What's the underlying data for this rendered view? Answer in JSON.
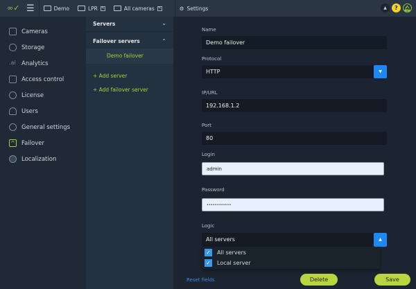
{
  "topbar": {
    "tabs": [
      {
        "label": "Demo",
        "editable": false
      },
      {
        "label": "LPR",
        "editable": true
      },
      {
        "label": "All cameras",
        "editable": true
      }
    ],
    "settings": "Settings",
    "help": "?"
  },
  "sidebar": {
    "items": [
      {
        "label": "Cameras",
        "icon": "camera-chip-icon"
      },
      {
        "label": "Storage",
        "icon": "database-icon"
      },
      {
        "label": "Analytics",
        "icon": "analytics-icon"
      },
      {
        "label": "Access control",
        "icon": "door-icon"
      },
      {
        "label": "License",
        "icon": "cloud-icon"
      },
      {
        "label": "Users",
        "icon": "user-icon"
      },
      {
        "label": "General settings",
        "icon": "gear-icon"
      },
      {
        "label": "Failover",
        "icon": "failover-icon",
        "active": true
      },
      {
        "label": "Localization",
        "icon": "globe-icon"
      }
    ]
  },
  "servers": {
    "servers_header": "Servers",
    "failover_header": "Failover servers",
    "selected": "Demo failover",
    "add_server": "+ Add server",
    "add_failover": "+ Add failover server"
  },
  "form": {
    "name_label": "Name",
    "name": "Demo failover",
    "protocol_label": "Protocol",
    "protocol": "HTTP",
    "ip_label": "IP/URL",
    "ip": "192.168.1.2",
    "port_label": "Port",
    "port": "80",
    "login_label": "Login",
    "login": "admin",
    "password_label": "Password",
    "password": "••••••••••••",
    "logic_label": "Logic",
    "logic": "All servers",
    "logic_options": [
      {
        "label": "All servers",
        "checked": true
      },
      {
        "label": "Local server",
        "checked": true
      }
    ],
    "reset": "Reset fields",
    "delete": "Delete",
    "save": "Save"
  },
  "colors": {
    "accent": "#a3d23a",
    "blue": "#1e88f5",
    "button": "#b9d540"
  }
}
